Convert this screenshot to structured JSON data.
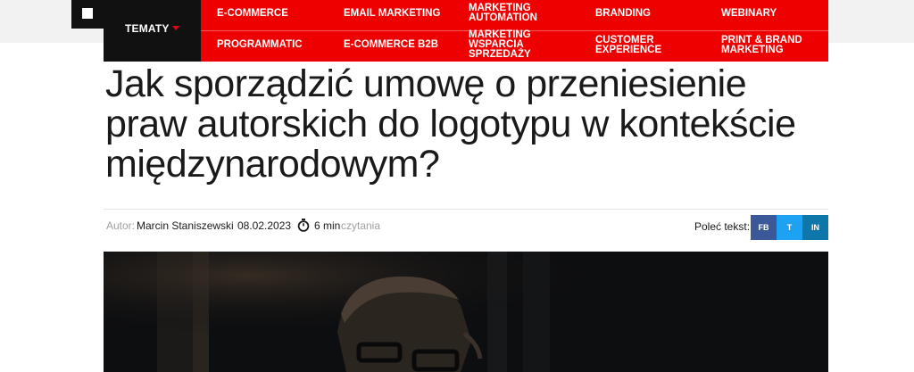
{
  "nav": {
    "topics_label": "TEMATY",
    "items": [
      "E-COMMERCE",
      "EMAIL MARKETING",
      "MARKETING\nAUTOMATION",
      "BRANDING",
      "WEBINARY",
      "PROGRAMMATIC",
      "E-COMMERCE B2B",
      "MARKETING\nWSPARCIA\nSPRZEDAŻY",
      "CUSTOMER\nEXPERIENCE",
      "PRINT & BRAND\nMARKETING"
    ]
  },
  "article": {
    "title": "Jak sporządzić umowę o przeniesienie praw autorskich do logotypu w kontekście międzynarodowym?",
    "author_label": "Autor:",
    "author": "Marcin Staniszewski",
    "date": "08.02.2023",
    "read_time": "6 min",
    "read_time_suffix": "czytania"
  },
  "share": {
    "label": "Poleć tekst:",
    "buttons": [
      "FB",
      "T",
      "IN"
    ]
  },
  "colors": {
    "nav_red": "#ef0000",
    "nav_black": "#111111",
    "facebook": "#3b5998",
    "twitter": "#1da1f2",
    "linkedin": "#0e76a8"
  }
}
